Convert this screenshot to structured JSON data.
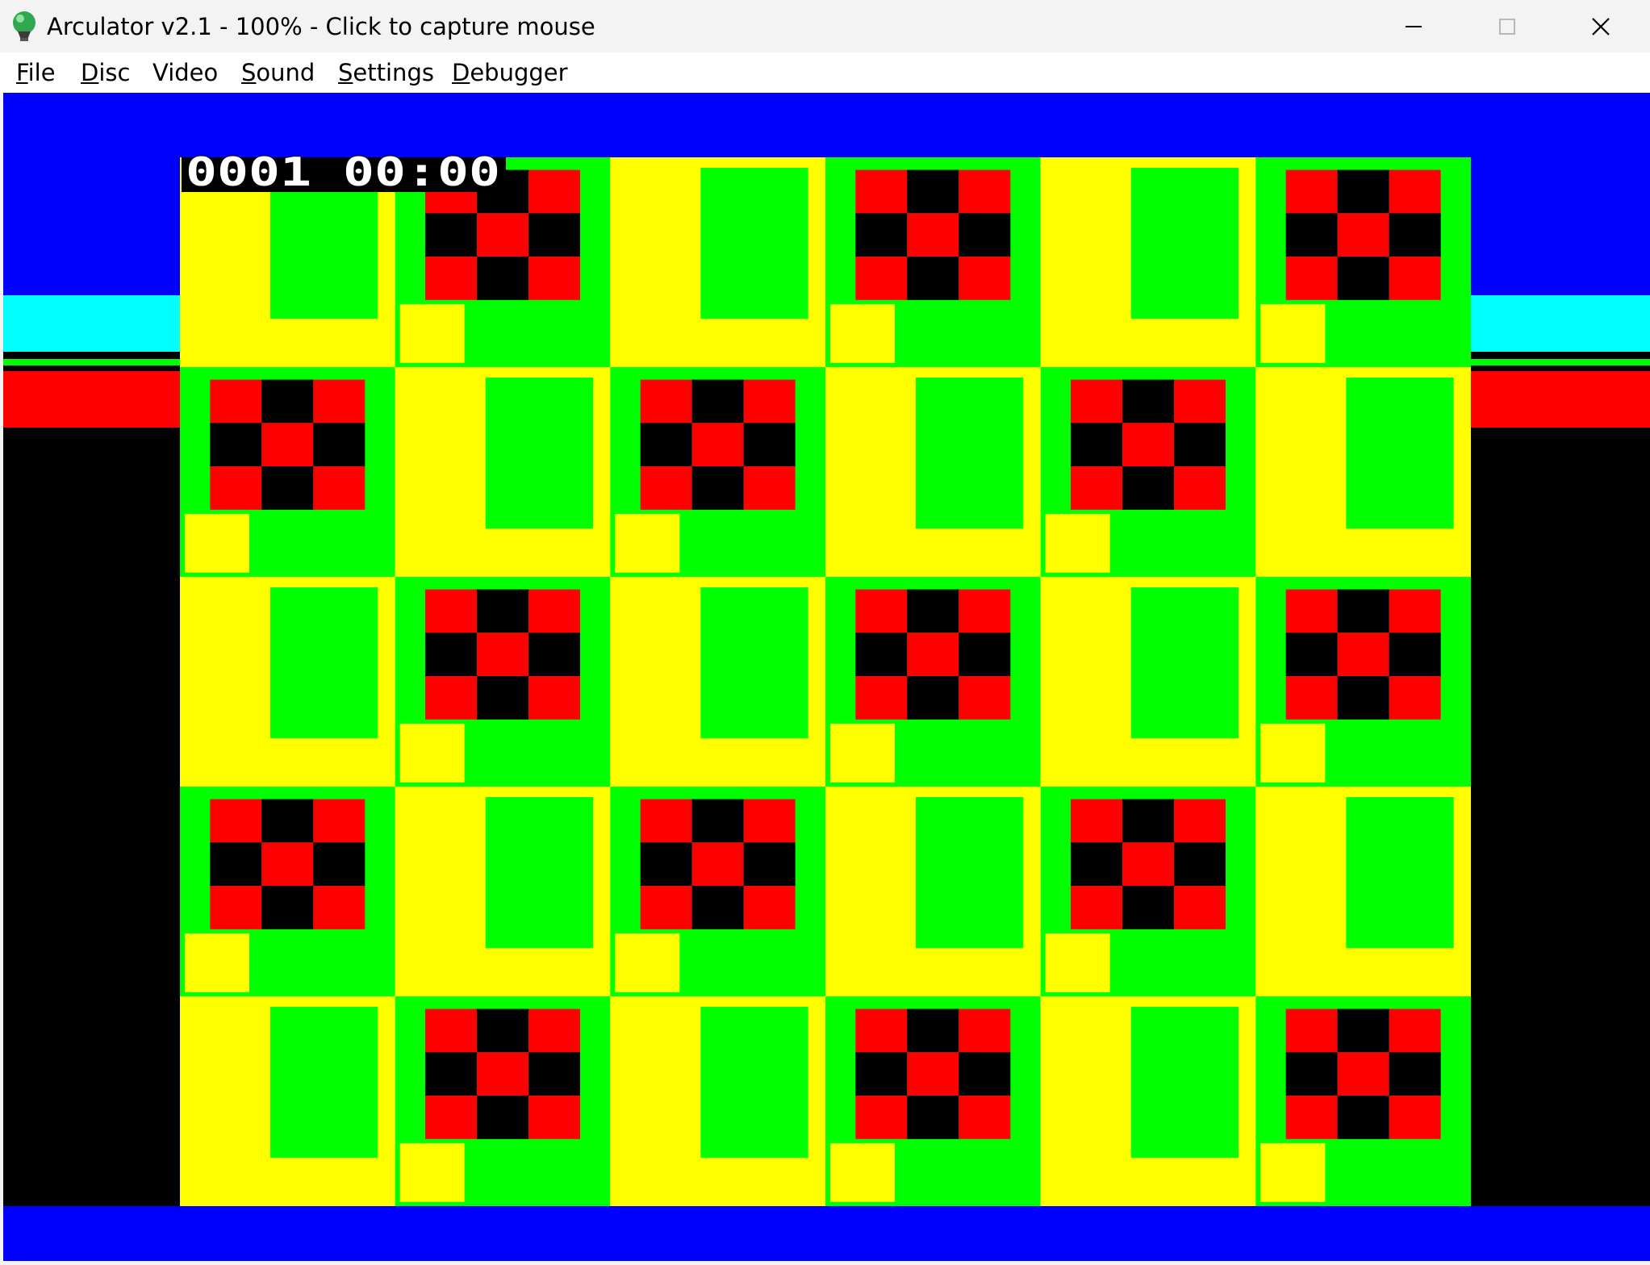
{
  "window": {
    "title": "Arculator v2.1 - 100% - Click to capture mouse",
    "app_icon": "green-balloon-icon",
    "controls": [
      "minimize-icon",
      "maximize-icon",
      "close-icon"
    ]
  },
  "menu": {
    "items": [
      {
        "label": "File",
        "mnemonic": "F"
      },
      {
        "label": "Disc",
        "mnemonic": "D"
      },
      {
        "label": "Video",
        "mnemonic": ""
      },
      {
        "label": "Sound",
        "mnemonic": "S"
      },
      {
        "label": "Settings",
        "mnemonic": "S"
      },
      {
        "label": "Debugger",
        "mnemonic": "D"
      }
    ]
  },
  "emulator": {
    "counter": "0001 00:00",
    "colors": {
      "sky": "#0000ff",
      "horizon": "#00ffff",
      "ground_band": "#ff0000",
      "floor": "#000000",
      "tile_yellow": "#ffff00",
      "tile_green": "#00ff00",
      "checker_red": "#ff0000",
      "checker_black": "#000000"
    }
  }
}
